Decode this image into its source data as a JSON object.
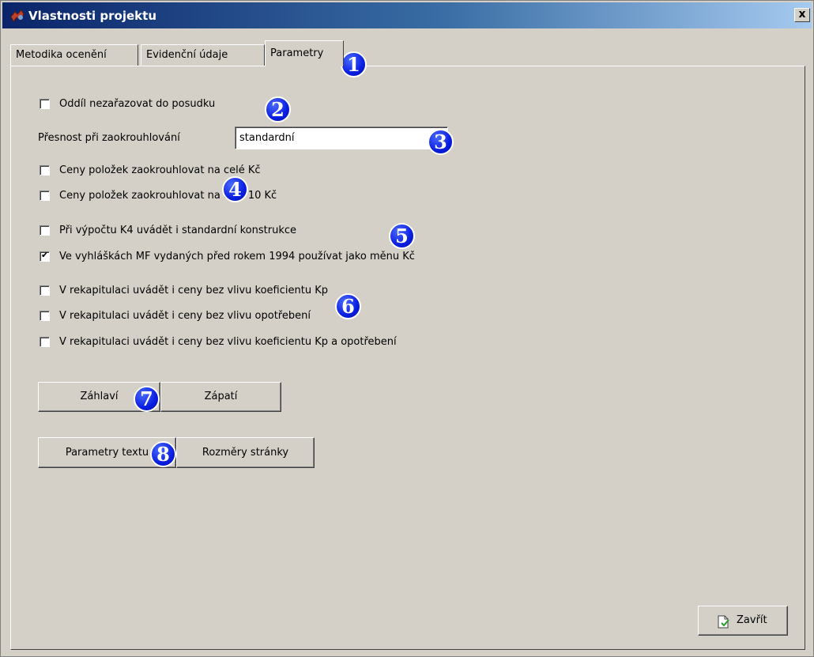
{
  "window": {
    "title": "Vlastnosti projektu",
    "close_label": "x"
  },
  "tabs": [
    {
      "label": "Metodika ocenění"
    },
    {
      "label": "Evidenční údaje"
    },
    {
      "label": "Parametry",
      "active": true
    }
  ],
  "options": {
    "oddil": {
      "label": "Oddíl nezařazovat do posudku",
      "checked": false
    },
    "presnost": {
      "label": "Přesnost při zaokrouhlování",
      "value": "standardní"
    },
    "ceny_kc": {
      "label": "Ceny položek zaokrouhlovat na celé Kč",
      "checked": false
    },
    "ceny_10kc": {
      "label": "Ceny položek zaokrouhlovat na celé 10 Kč",
      "checked": false
    },
    "k4": {
      "label": "Při výpočtu K4 uvádět i standardní konstrukce",
      "checked": false
    },
    "mf": {
      "label": "Ve vyhláškách MF vydaných před rokem 1994 používat jako měnu Kč",
      "checked": true
    },
    "rek_kp": {
      "label": "V rekapitulaci uvádět i ceny bez vlivu koeficientu Kp",
      "checked": false
    },
    "rek_opo": {
      "label": "V rekapitulaci uvádět i ceny bez vlivu opotřebení",
      "checked": false
    },
    "rek_kp_opo": {
      "label": "V rekapitulaci uvádět i ceny bez vlivu koeficientu Kp a opotřebení",
      "checked": false
    }
  },
  "buttons": {
    "zahlavi": "Záhlaví",
    "zapati": "Zápatí",
    "parametry_textu": "Parametry textu",
    "rozmery": "Rozměry stránky",
    "zavrit": "Zavřít"
  },
  "markers": [
    "1",
    "2",
    "3",
    "4",
    "5",
    "6",
    "7",
    "8"
  ],
  "colors": {
    "marker": "#0a1ee0",
    "titlebar": "#0a246a",
    "face": "#d4d0c8"
  }
}
